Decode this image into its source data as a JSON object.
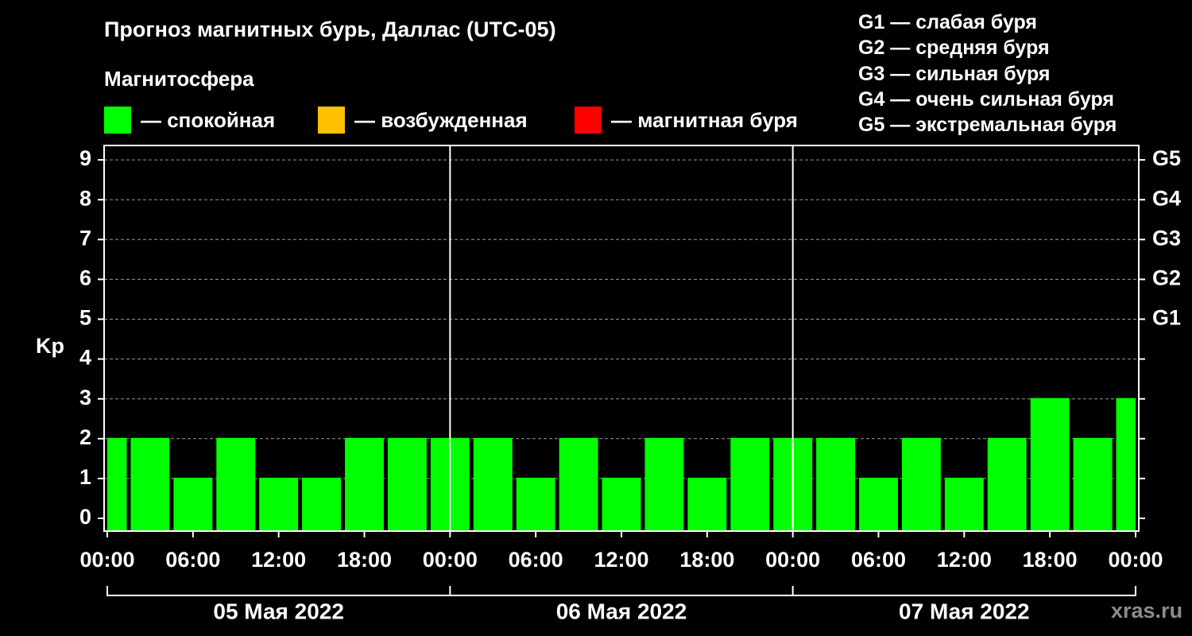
{
  "header": {
    "title": "Прогноз магнитных бурь, Даллас (UTC-05)",
    "subtitle": "Магнитосфера"
  },
  "legend": [
    {
      "label": "— спокойная",
      "color": "#00ff00"
    },
    {
      "label": "— возбужденная",
      "color": "#ffc000"
    },
    {
      "label": "— магнитная буря",
      "color": "#ff0000"
    }
  ],
  "g_scale": [
    {
      "text": "G1 — слабая буря"
    },
    {
      "text": "G2 — средняя буря"
    },
    {
      "text": "G3 — сильная буря"
    },
    {
      "text": "G4 — очень сильная буря"
    },
    {
      "text": "G5 — экстремальная буря"
    }
  ],
  "site": "xras.ru",
  "chart_data": {
    "type": "bar",
    "ylabel": "Kp",
    "ylim": [
      0,
      9
    ],
    "yticks": [
      0,
      1,
      2,
      3,
      4,
      5,
      6,
      7,
      8,
      9
    ],
    "right_ticks": [
      {
        "value": 5,
        "label": "G1"
      },
      {
        "value": 6,
        "label": "G2"
      },
      {
        "value": 7,
        "label": "G3"
      },
      {
        "value": 8,
        "label": "G4"
      },
      {
        "value": 9,
        "label": "G5"
      }
    ],
    "grid": "horizontal dashed",
    "x_tick_labels": [
      "00:00",
      "06:00",
      "12:00",
      "18:00",
      "00:00",
      "06:00",
      "12:00",
      "18:00",
      "00:00",
      "06:00",
      "12:00",
      "18:00",
      "00:00"
    ],
    "days": [
      "05 Мая 2022",
      "06 Мая 2022",
      "07 Мая 2022"
    ],
    "bar_interval_hours": 3,
    "bar_color": "#00ff00",
    "values": [
      2,
      2,
      1,
      2,
      1,
      1,
      2,
      2,
      2,
      2,
      1,
      2,
      1,
      2,
      1,
      2,
      2,
      2,
      1,
      2,
      1,
      2,
      3,
      2,
      3
    ]
  }
}
